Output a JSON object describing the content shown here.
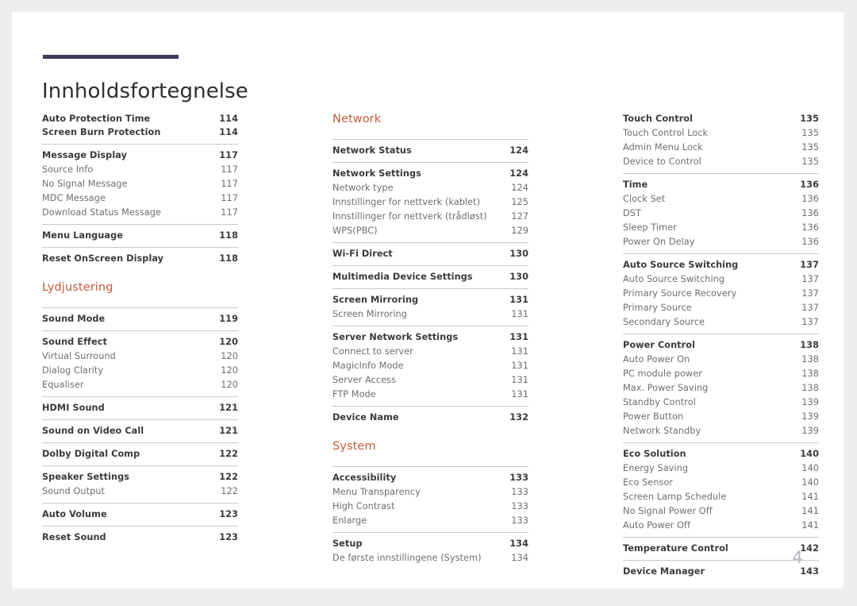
{
  "document": {
    "title": "Innholdsfortegnelse",
    "folio": "4",
    "accent_color": "#c8593c",
    "rule_color": "#3f3d56"
  },
  "columns": [
    {
      "name": "column-1",
      "groups": [
        {
          "kind": "entries",
          "first_no_rule": true,
          "entries": [
            {
              "level": 1,
              "label": "Auto Protection Time",
              "page": "114",
              "no_rule": true
            },
            {
              "level": 1,
              "label": "Screen Burn Protection",
              "page": "114",
              "no_rule": true
            }
          ]
        },
        {
          "kind": "entries",
          "entries": [
            {
              "level": 1,
              "label": "Message Display",
              "page": "117"
            },
            {
              "level": 2,
              "label": "Source Info",
              "page": "117"
            },
            {
              "level": 2,
              "label": "No Signal Message",
              "page": "117"
            },
            {
              "level": 2,
              "label": "MDC Message",
              "page": "117"
            },
            {
              "level": 2,
              "label": "Download Status Message",
              "page": "117"
            }
          ]
        },
        {
          "kind": "entries",
          "entries": [
            {
              "level": 1,
              "label": "Menu Language",
              "page": "118"
            }
          ]
        },
        {
          "kind": "entries",
          "entries": [
            {
              "level": 1,
              "label": "Reset OnScreen Display",
              "page": "118"
            }
          ]
        },
        {
          "kind": "heading",
          "heading": "Lydjustering"
        },
        {
          "kind": "entries",
          "entries": [
            {
              "level": 1,
              "label": "Sound Mode",
              "page": "119"
            }
          ]
        },
        {
          "kind": "entries",
          "entries": [
            {
              "level": 1,
              "label": "Sound Effect",
              "page": "120"
            },
            {
              "level": 2,
              "label": "Virtual Surround",
              "page": "120"
            },
            {
              "level": 2,
              "label": "Dialog Clarity",
              "page": "120"
            },
            {
              "level": 2,
              "label": "Equaliser",
              "page": "120"
            }
          ]
        },
        {
          "kind": "entries",
          "entries": [
            {
              "level": 1,
              "label": "HDMI Sound",
              "page": "121"
            }
          ]
        },
        {
          "kind": "entries",
          "entries": [
            {
              "level": 1,
              "label": "Sound on Video Call",
              "page": "121"
            }
          ]
        },
        {
          "kind": "entries",
          "entries": [
            {
              "level": 1,
              "label": "Dolby Digital Comp",
              "page": "122"
            }
          ]
        },
        {
          "kind": "entries",
          "entries": [
            {
              "level": 1,
              "label": "Speaker Settings",
              "page": "122"
            },
            {
              "level": 2,
              "label": "Sound Output",
              "page": "122"
            }
          ]
        },
        {
          "kind": "entries",
          "entries": [
            {
              "level": 1,
              "label": "Auto Volume",
              "page": "123"
            }
          ]
        },
        {
          "kind": "entries",
          "entries": [
            {
              "level": 1,
              "label": "Reset Sound",
              "page": "123"
            }
          ]
        }
      ]
    },
    {
      "name": "column-2",
      "groups": [
        {
          "kind": "heading",
          "heading": "Network",
          "first": true
        },
        {
          "kind": "entries",
          "entries": [
            {
              "level": 1,
              "label": "Network Status",
              "page": "124"
            }
          ]
        },
        {
          "kind": "entries",
          "entries": [
            {
              "level": 1,
              "label": "Network Settings",
              "page": "124"
            },
            {
              "level": 2,
              "label": "Network type",
              "page": "124"
            },
            {
              "level": 2,
              "label": "Innstillinger for nettverk (kablet)",
              "page": "125"
            },
            {
              "level": 2,
              "label": "Innstillinger for nettverk (trådløst)",
              "page": "127"
            },
            {
              "level": 2,
              "label": "WPS(PBC)",
              "page": "129"
            }
          ]
        },
        {
          "kind": "entries",
          "entries": [
            {
              "level": 1,
              "label": "Wi-Fi Direct",
              "page": "130"
            }
          ]
        },
        {
          "kind": "entries",
          "entries": [
            {
              "level": 1,
              "label": "Multimedia Device Settings",
              "page": "130"
            }
          ]
        },
        {
          "kind": "entries",
          "entries": [
            {
              "level": 1,
              "label": "Screen Mirroring",
              "page": "131"
            },
            {
              "level": 2,
              "label": "Screen Mirroring",
              "page": "131"
            }
          ]
        },
        {
          "kind": "entries",
          "entries": [
            {
              "level": 1,
              "label": "Server Network Settings",
              "page": "131"
            },
            {
              "level": 2,
              "label": "Connect to server",
              "page": "131"
            },
            {
              "level": 2,
              "label": "MagicInfo Mode",
              "page": "131"
            },
            {
              "level": 2,
              "label": "Server Access",
              "page": "131"
            },
            {
              "level": 2,
              "label": "FTP Mode",
              "page": "131"
            }
          ]
        },
        {
          "kind": "entries",
          "entries": [
            {
              "level": 1,
              "label": "Device Name",
              "page": "132"
            }
          ]
        },
        {
          "kind": "heading",
          "heading": "System"
        },
        {
          "kind": "entries",
          "entries": [
            {
              "level": 1,
              "label": "Accessibility",
              "page": "133"
            },
            {
              "level": 2,
              "label": "Menu Transparency",
              "page": "133"
            },
            {
              "level": 2,
              "label": "High Contrast",
              "page": "133"
            },
            {
              "level": 2,
              "label": "Enlarge",
              "page": "133"
            }
          ]
        },
        {
          "kind": "entries",
          "entries": [
            {
              "level": 1,
              "label": "Setup",
              "page": "134"
            },
            {
              "level": 2,
              "label": "De første innstillingene (System)",
              "page": "134"
            }
          ]
        }
      ]
    },
    {
      "name": "column-3",
      "groups": [
        {
          "kind": "entries",
          "entries": [
            {
              "level": 1,
              "label": "Touch Control",
              "page": "135",
              "no_rule": true
            },
            {
              "level": 2,
              "label": "Touch Control Lock",
              "page": "135"
            },
            {
              "level": 2,
              "label": "Admin Menu Lock",
              "page": "135"
            },
            {
              "level": 2,
              "label": "Device to Control",
              "page": "135"
            }
          ]
        },
        {
          "kind": "entries",
          "entries": [
            {
              "level": 1,
              "label": "Time",
              "page": "136"
            },
            {
              "level": 2,
              "label": "Clock Set",
              "page": "136"
            },
            {
              "level": 2,
              "label": "DST",
              "page": "136"
            },
            {
              "level": 2,
              "label": "Sleep Timer",
              "page": "136"
            },
            {
              "level": 2,
              "label": "Power On Delay",
              "page": "136"
            }
          ]
        },
        {
          "kind": "entries",
          "entries": [
            {
              "level": 1,
              "label": "Auto Source Switching",
              "page": "137"
            },
            {
              "level": 2,
              "label": "Auto Source Switching",
              "page": "137"
            },
            {
              "level": 2,
              "label": "Primary Source Recovery",
              "page": "137"
            },
            {
              "level": 2,
              "label": "Primary Source",
              "page": "137"
            },
            {
              "level": 2,
              "label": "Secondary Source",
              "page": "137"
            }
          ]
        },
        {
          "kind": "entries",
          "entries": [
            {
              "level": 1,
              "label": "Power Control",
              "page": "138"
            },
            {
              "level": 2,
              "label": "Auto Power On",
              "page": "138"
            },
            {
              "level": 2,
              "label": "PC module power",
              "page": "138"
            },
            {
              "level": 2,
              "label": "Max. Power Saving",
              "page": "138"
            },
            {
              "level": 2,
              "label": "Standby Control",
              "page": "139"
            },
            {
              "level": 2,
              "label": "Power Button",
              "page": "139"
            },
            {
              "level": 2,
              "label": "Network Standby",
              "page": "139"
            }
          ]
        },
        {
          "kind": "entries",
          "entries": [
            {
              "level": 1,
              "label": "Eco Solution",
              "page": "140"
            },
            {
              "level": 2,
              "label": "Energy Saving",
              "page": "140"
            },
            {
              "level": 2,
              "label": "Eco Sensor",
              "page": "140"
            },
            {
              "level": 2,
              "label": "Screen Lamp Schedule",
              "page": "141"
            },
            {
              "level": 2,
              "label": "No Signal Power Off",
              "page": "141"
            },
            {
              "level": 2,
              "label": "Auto Power Off",
              "page": "141"
            }
          ]
        },
        {
          "kind": "entries",
          "entries": [
            {
              "level": 1,
              "label": "Temperature Control",
              "page": "142"
            }
          ]
        },
        {
          "kind": "entries",
          "entries": [
            {
              "level": 1,
              "label": "Device Manager",
              "page": "143"
            }
          ]
        }
      ]
    }
  ]
}
